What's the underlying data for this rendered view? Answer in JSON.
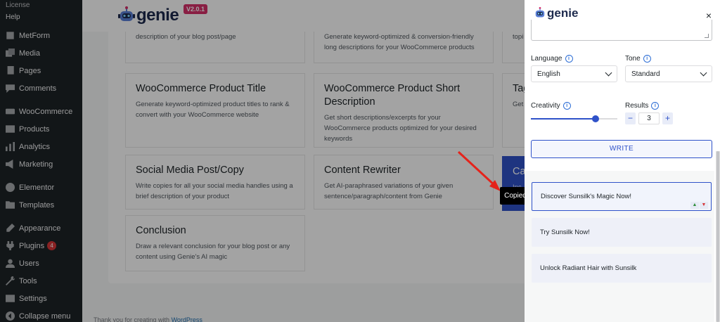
{
  "sidebar": {
    "top_links": [
      "License",
      "Help"
    ],
    "items": [
      {
        "label": "MetForm",
        "icon": "metform-icon"
      },
      {
        "label": "Media",
        "icon": "media-icon"
      },
      {
        "label": "Pages",
        "icon": "pages-icon"
      },
      {
        "label": "Comments",
        "icon": "comments-icon"
      },
      {
        "label": "WooCommerce",
        "icon": "woocommerce-icon"
      },
      {
        "label": "Products",
        "icon": "products-icon"
      },
      {
        "label": "Analytics",
        "icon": "analytics-icon"
      },
      {
        "label": "Marketing",
        "icon": "marketing-icon"
      },
      {
        "label": "Elementor",
        "icon": "elementor-icon"
      },
      {
        "label": "Templates",
        "icon": "templates-icon"
      },
      {
        "label": "Appearance",
        "icon": "appearance-icon"
      },
      {
        "label": "Plugins",
        "icon": "plugins-icon",
        "badge": "4"
      },
      {
        "label": "Users",
        "icon": "users-icon"
      },
      {
        "label": "Tools",
        "icon": "tools-icon"
      },
      {
        "label": "Settings",
        "icon": "settings-icon"
      },
      {
        "label": "Collapse menu",
        "icon": "collapse-icon"
      }
    ]
  },
  "header": {
    "brand": "genie",
    "version": "V2.0.1"
  },
  "cards": {
    "c1_desc": "description of your blog post/page",
    "c2_desc": "Generate keyword-optimized & conversion-friendly long descriptions for your WooCommerce products",
    "c3_desc_partial": "topi",
    "c4_title": "WooCommerce Product Title",
    "c4_desc": "Generate keyword-optimized product titles to rank & convert with your WooCommerce website",
    "c5_title": "WooCommerce Product Short Description",
    "c5_desc": "Get short descriptions/excerpts for your WooCommerce products optimized for your desired keywords",
    "c6_title_partial": "Tag",
    "c6_desc_partial": "Get",
    "c7_title": "Social Media Post/Copy",
    "c7_desc": "Write copies for all your social media handles using a brief description of your product",
    "c8_title": "Content Rewriter",
    "c8_desc": "Get AI-paraphrased variations of your given sentence/paragraph/content from Genie",
    "c9_title_partial": "Ca",
    "c9_desc_partial": "Inc",
    "c10_title": "Conclusion",
    "c10_desc": "Draw a relevant conclusion for your blog post or any content using Genie's AI magic"
  },
  "footer": {
    "text": "Thank you for creating with",
    "link": "WordPress"
  },
  "drawer": {
    "brand": "genie",
    "close_label": "×",
    "language_label": "Language",
    "language_value": "English",
    "tone_label": "Tone",
    "tone_value": "Standard",
    "creativity_label": "Creativity",
    "creativity_level": 0.75,
    "results_label": "Results",
    "results_value": "3",
    "minus": "−",
    "plus": "+",
    "write_label": "WRITE",
    "results": [
      "Discover Sunsilk's Magic Now!",
      "Try Sunsilk Now!",
      "Unlock Radiant Hair with Sunsilk"
    ]
  },
  "tooltip": {
    "text": "Copied"
  },
  "colors": {
    "accent": "#2f52c9",
    "version_badge": "#d6306a",
    "wp_sidebar": "#1d2327",
    "annotation_arrow": "#e5231b"
  }
}
